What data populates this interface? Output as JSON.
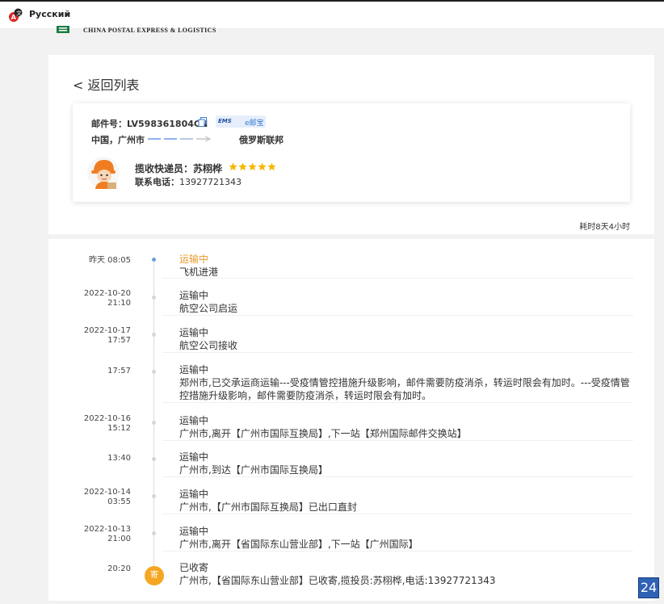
{
  "header": {
    "language": "Русский",
    "brand_text": "CHINA POSTAL EXPRESS & LOGISTICS"
  },
  "detail": {
    "back_label": "< 返回列表",
    "mail_label": "邮件号：",
    "mail_number": "LV598361804CN",
    "ems_logo": "EMS",
    "ems_name": "e邮宝",
    "origin": "中国，广州市",
    "destination": "俄罗斯联邦",
    "courier_label": "揽收快递员：",
    "courier_name": "苏栩桦",
    "rating": 5,
    "phone_label": "联系电话：",
    "phone": "13927721343",
    "elapsed": "耗时8天4小时"
  },
  "timeline": [
    {
      "date": "昨天 08:05",
      "time": "",
      "status": "运输中",
      "detail": "飞机进港"
    },
    {
      "date": "2022-10-20",
      "time": "21:10",
      "status": "运输中",
      "detail": "航空公司启运"
    },
    {
      "date": "2022-10-17",
      "time": "17:57",
      "status": "运输中",
      "detail": "航空公司接收"
    },
    {
      "date": "17:57",
      "time": "",
      "status": "运输中",
      "detail": "郑州市,已交承运商运输---受疫情管控措施升级影响，邮件需要防疫消杀，转运时限会有加时。---受疫情管控措施升级影响，邮件需要防疫消杀，转运时限会有加时。"
    },
    {
      "date": "2022-10-16",
      "time": "15:12",
      "status": "运输中",
      "detail": "广州市,离开【广州市国际互换局】,下一站【郑州国际邮件交换站】"
    },
    {
      "date": "13:40",
      "time": "",
      "status": "运输中",
      "detail": "广州市,到达【广州市国际互换局】"
    },
    {
      "date": "2022-10-14",
      "time": "03:55",
      "status": "运输中",
      "detail": "广州市,【广州市国际互换局】已出口直封"
    },
    {
      "date": "2022-10-13",
      "time": "21:00",
      "status": "运输中",
      "detail": "广州市,离开【省国际东山营业部】,下一站【广州国际】"
    },
    {
      "date": "20:20",
      "time": "",
      "status": "已收寄",
      "detail": "广州市,【省国际东山营业部】已收寄,揽投员:苏栩桦,电话:13927721343"
    }
  ],
  "timeline_end_badge": "寄",
  "page_badge": "24",
  "colors": {
    "accent_orange": "#e89a2b",
    "dot_blue": "#6aa0e0",
    "brand_green": "#1e7b45",
    "badge_blue": "#2e62b5"
  }
}
